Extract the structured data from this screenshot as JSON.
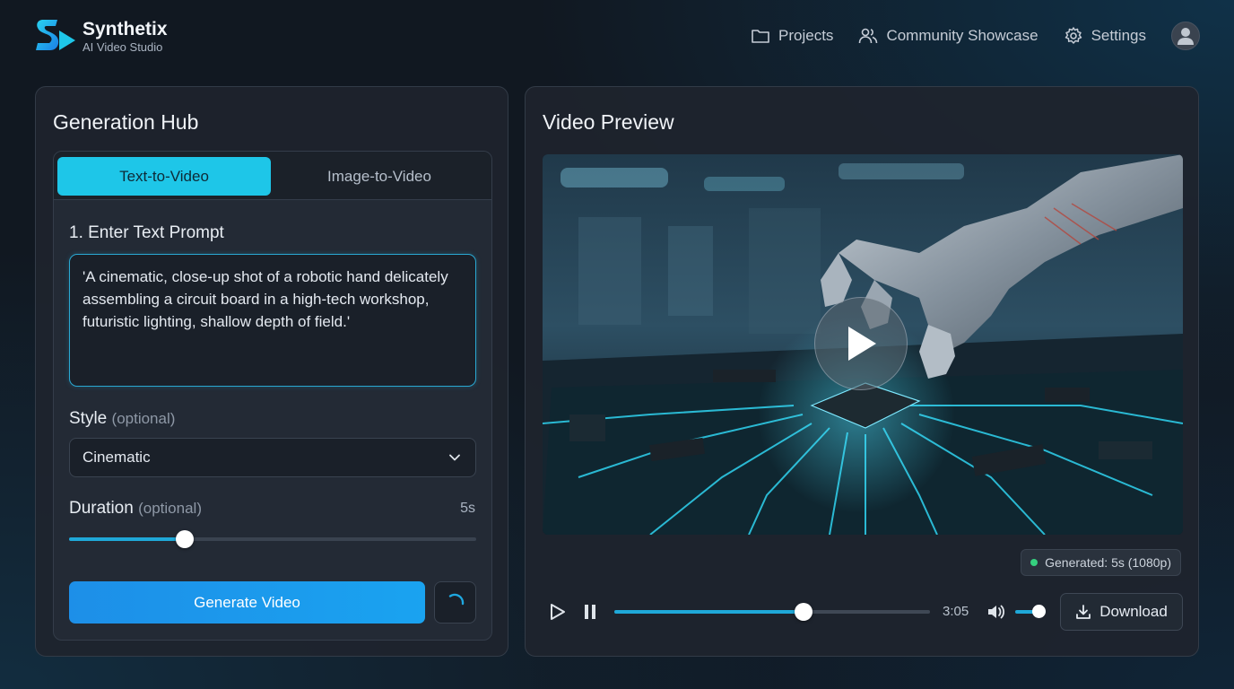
{
  "brand": {
    "name": "Synthetix",
    "subtitle": "AI Video Studio"
  },
  "nav": {
    "projects": "Projects",
    "community": "Community Showcase",
    "settings": "Settings"
  },
  "left": {
    "title": "Generation Hub",
    "tabs": {
      "active": "Text-to-Video",
      "inactive": "Image-to-Video"
    },
    "prompt_label": "1. Enter Text Prompt",
    "prompt_value": "'A cinematic, close-up shot of a robotic hand delicately assembling a circuit board in a high-tech workshop, futuristic lighting, shallow depth of field.'",
    "style_label": "Style",
    "style_optional": "(optional)",
    "style_value": "Cinematic",
    "duration_label": "Duration",
    "duration_optional": "(optional)",
    "duration_value": "5s",
    "duration_fraction": 0.285,
    "generate_label": "Generate Video"
  },
  "right": {
    "title": "Video Preview",
    "badge": "Generated: 5s (1080p)",
    "time": "3:05",
    "progress_fraction": 0.6,
    "volume_fraction": 1.0,
    "download_label": "Download"
  },
  "colors": {
    "accent": "#1ec6e8",
    "primary": "#1d8fe8",
    "status": "#35d07f"
  }
}
